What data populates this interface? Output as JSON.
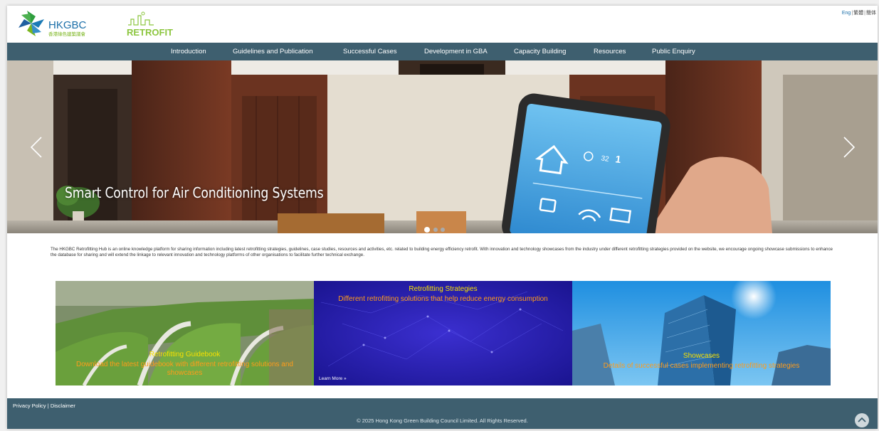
{
  "header": {
    "logo_text": "HKGBC",
    "logo_chinese": "香港綠色建築議會",
    "logo_retrofit": "RETROFIT",
    "lang_eng": "Eng",
    "lang_sep": "|",
    "lang_trad": "繁體",
    "lang_simp": "簡体"
  },
  "nav": {
    "items": [
      {
        "label": "Introduction"
      },
      {
        "label": "Guidelines and Publication"
      },
      {
        "label": "Successful Cases"
      },
      {
        "label": "Development in GBA"
      },
      {
        "label": "Capacity Building"
      },
      {
        "label": "Resources"
      },
      {
        "label": "Public Enquiry"
      }
    ]
  },
  "hero": {
    "caption": "Smart Control for Air Conditioning Systems",
    "phone_temp": "32",
    "phone_date": "1"
  },
  "intro": {
    "text": "The HKGBC Retrofitting Hub is an online knowledge platform for sharing information including latest retrofitting strategies, guidelines, case studies, resources and activities, etc. related to building energy efficiency retrofit.  With innovation and technology showcases from the industry under different retrofitting strategies provided on the website, we encourage ongoing showcase submissions to enhance the database for sharing and will extend the linkage to relevant innovation and technology platforms of other organisations to facilitate further technical exchange."
  },
  "tiles": [
    {
      "title": "Retrofitting Guidebook",
      "subtitle": "Download the latest guidebook with different retrofitting solutions and showcases"
    },
    {
      "title": "Retrofitting Strategies",
      "subtitle": "Different retrofitting solutions that help reduce energy consumption",
      "link": "Learn More »"
    },
    {
      "title": "Showcases",
      "subtitle": "Details of successful cases implementing retrofitting strategies"
    }
  ],
  "footer": {
    "privacy": "Privacy Policy",
    "sep": "|",
    "disclaimer": "Disclaimer",
    "copyright": "© 2025 Hong Kong Green Building Council Limited. All Rights Reserved."
  },
  "colors": {
    "nav_bg": "#3e5f6f",
    "tile_title": "#f7e000",
    "tile_sub": "#ff9c1a",
    "brand_green": "#7ab51d",
    "brand_blue": "#1a7ab5"
  },
  "icons": [
    "retrofit-skyline-icon",
    "chevron-left-icon",
    "chevron-right-icon",
    "arrow-up-icon"
  ]
}
